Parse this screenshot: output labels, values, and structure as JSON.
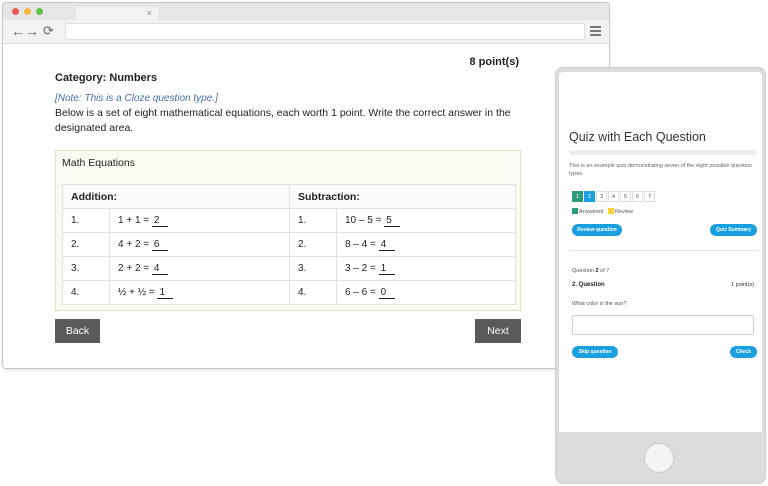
{
  "browser": {
    "tab_close": "×",
    "nav": {
      "back": "←",
      "forward": "→",
      "reload": "⟳"
    }
  },
  "question_page": {
    "points": "8 point(s)",
    "category": "Category: Numbers",
    "note": "[Note: This is a Cloze question type.]",
    "instructions": "Below is a set of eight mathematical equations, each worth 1 point. Write the correct answer in the designated area.",
    "equations_title": "Math Equations",
    "headers": {
      "addition": "Addition:",
      "subtraction": "Subtraction:"
    },
    "rows": [
      {
        "add_num": "1.",
        "add_expr": "1 + 1 =",
        "add_ans": "2",
        "sub_num": "1.",
        "sub_expr": "10 – 5 =",
        "sub_ans": "5"
      },
      {
        "add_num": "2.",
        "add_expr": "4 + 2 =",
        "add_ans": "6",
        "sub_num": "2.",
        "sub_expr": "8 – 4 =",
        "sub_ans": "4"
      },
      {
        "add_num": "3.",
        "add_expr": "2 + 2 =",
        "add_ans": "4",
        "sub_num": "3.",
        "sub_expr": "3 – 2 =",
        "sub_ans": "1"
      },
      {
        "add_num": "4.",
        "add_expr": "½ + ½ =",
        "add_ans": "1",
        "sub_num": "4.",
        "sub_expr": "6 – 6 =",
        "sub_ans": "0"
      }
    ],
    "back_label": "Back",
    "next_label": "Next"
  },
  "phone": {
    "quiz_title": "Quiz with Each Question",
    "description": "This is an example quiz demonstrating seven of the eight possible question types.",
    "question_numbers": [
      "1",
      "2",
      "3",
      "4",
      "5",
      "6",
      "7"
    ],
    "legend": {
      "answered": "Answered",
      "review": "Review"
    },
    "review_button": "Review question",
    "summary_button": "Quiz Summary",
    "question_word": "Question",
    "current_question": "2",
    "of_word": "of",
    "total_questions": "7",
    "question_name": "2. Question",
    "question_points": "1 point(s)",
    "question_text": "What color is the sun?",
    "skip_button": "Skip question",
    "check_button": "Check"
  },
  "colors": {
    "accent_blue": "#1aa0de",
    "answered_green": "#2e9a7c",
    "review_yellow": "#f5d33c",
    "button_dark": "#5a5a5a"
  }
}
